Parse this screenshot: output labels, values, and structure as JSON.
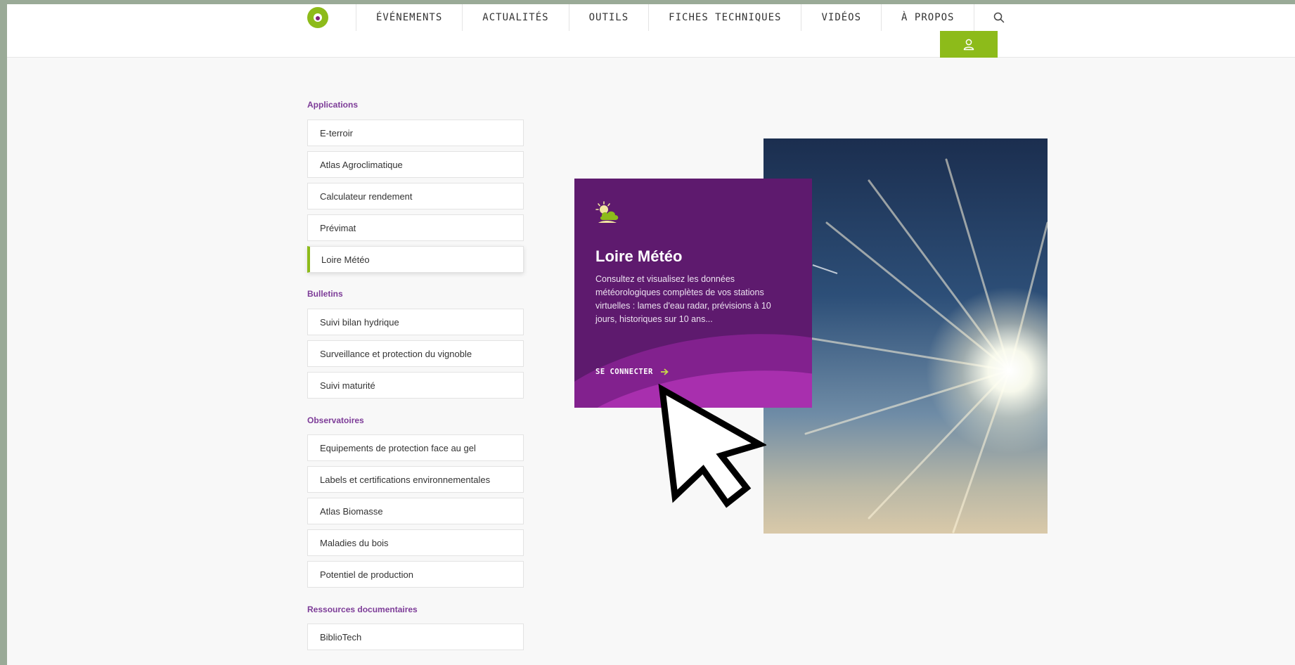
{
  "colors": {
    "accent_green": "#8dbb1a",
    "accent_purple": "#7d3c98",
    "card_bg": "#5e1a6e"
  },
  "header": {
    "nav": [
      "ÉVÉNEMENTS",
      "ACTUALITÉS",
      "OUTILS",
      "FICHES TECHNIQUES",
      "VIDÉOS",
      "À PROPOS"
    ],
    "search_icon": "search-icon",
    "account_icon": "user-icon"
  },
  "sidebar": {
    "sections": [
      {
        "title": "Applications",
        "items": [
          "E-terroir",
          "Atlas Agroclimatique",
          "Calculateur rendement",
          "Prévimat",
          "Loire Météo"
        ]
      },
      {
        "title": "Bulletins",
        "items": [
          "Suivi bilan hydrique",
          "Surveillance et protection du vignoble",
          "Suivi maturité"
        ]
      },
      {
        "title": "Observatoires",
        "items": [
          "Equipements de protection face au gel",
          "Labels et certifications environnementales",
          "Atlas Biomasse",
          "Maladies du bois",
          "Potentiel de production"
        ]
      },
      {
        "title": "Ressources documentaires",
        "items": [
          "BiblioTech"
        ]
      }
    ],
    "active_item": "Loire Météo"
  },
  "card": {
    "icon": "weather-sun-cloud-icon",
    "title": "Loire Météo",
    "description": "Consultez et visualisez les données météorologiques complètes de vos stations virtuelles : lames d'eau radar, prévisions à 10 jours, historiques sur 10 ans...",
    "cta": "SE CONNECTER"
  }
}
